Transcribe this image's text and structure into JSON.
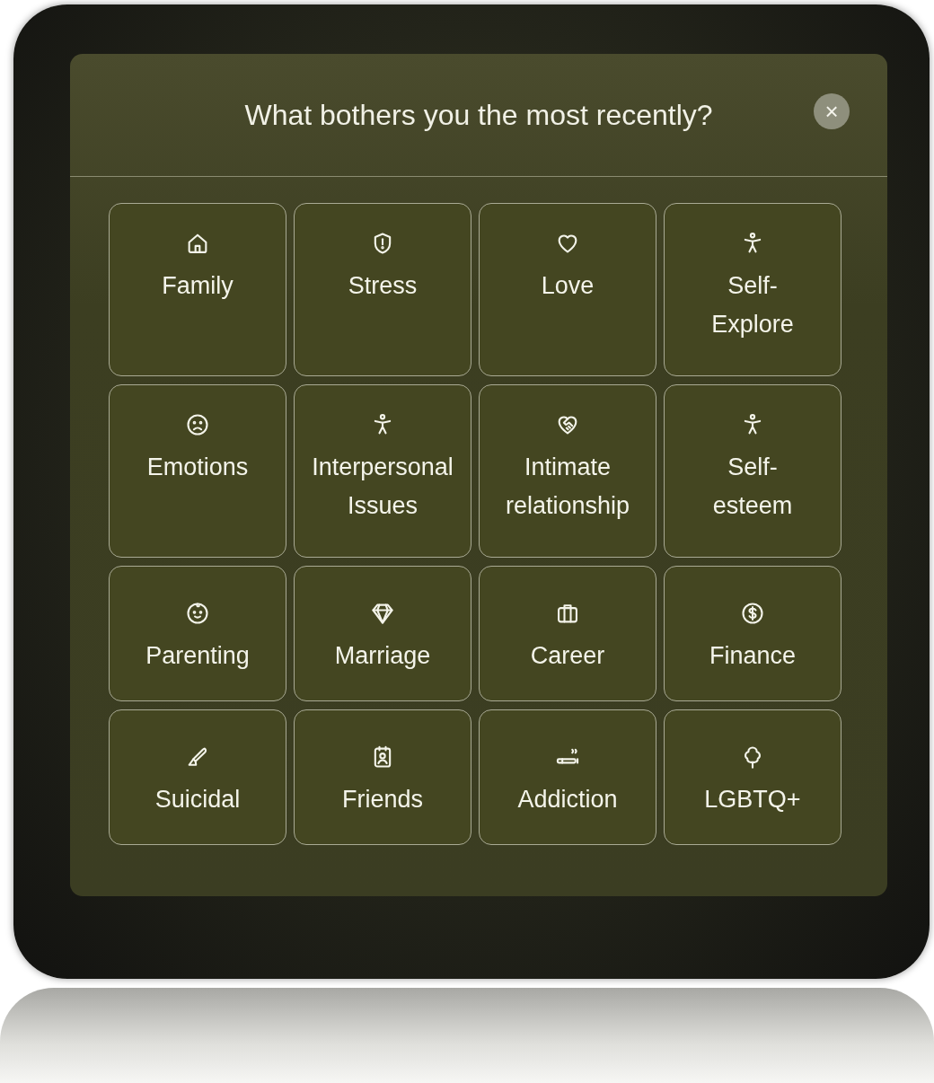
{
  "dialog": {
    "title": "What bothers you the most recently?",
    "close_label": "×",
    "topics": [
      {
        "label": "Family",
        "kind": "house"
      },
      {
        "label": "Stress",
        "kind": "shield"
      },
      {
        "label": "Love",
        "kind": "heart"
      },
      {
        "label": "Self-Explore",
        "kind": "person"
      },
      {
        "label": "Emotions",
        "kind": "sad"
      },
      {
        "label": "Interpersonal Issues",
        "kind": "person"
      },
      {
        "label": "Intimate relationship",
        "kind": "handheart"
      },
      {
        "label": "Self-esteem",
        "kind": "person"
      },
      {
        "label": "Parenting",
        "kind": "baby"
      },
      {
        "label": "Marriage",
        "kind": "diamond"
      },
      {
        "label": "Career",
        "kind": "briefcase"
      },
      {
        "label": "Finance",
        "kind": "dollar"
      },
      {
        "label": "Suicidal",
        "kind": "blade"
      },
      {
        "label": "Friends",
        "kind": "badge"
      },
      {
        "label": "Addiction",
        "kind": "cigarette"
      },
      {
        "label": "LGBTQ+",
        "kind": "tree"
      }
    ]
  }
}
